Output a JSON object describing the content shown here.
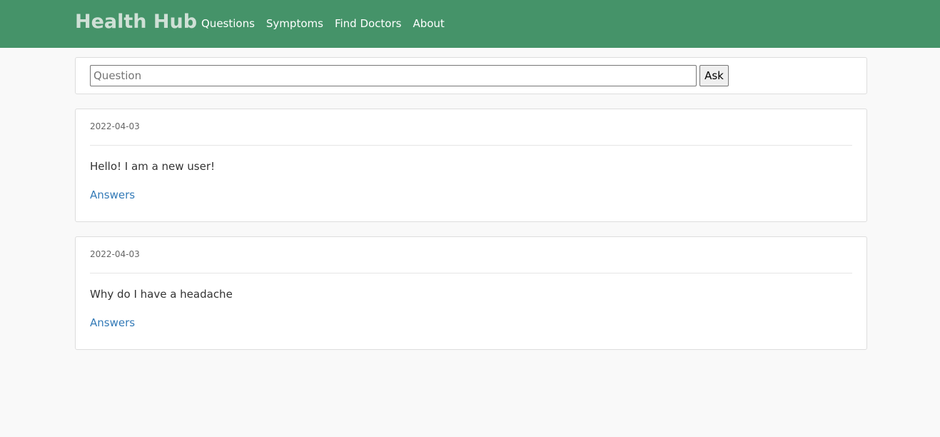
{
  "navbar": {
    "brand": "Health Hub",
    "links": [
      "Questions",
      "Symptoms",
      "Find Doctors",
      "About"
    ]
  },
  "ask": {
    "placeholder": "Question",
    "value": "",
    "button_label": "Ask"
  },
  "questions": [
    {
      "date": "2022-04-03",
      "text": "Hello! I am a new user!",
      "answers_label": "Answers"
    },
    {
      "date": "2022-04-03",
      "text": "Why do I have a headache",
      "answers_label": "Answers"
    }
  ],
  "colors": {
    "navbar_bg": "#459369",
    "brand_text": "#cfe0d6",
    "link": "#337ab7",
    "page_bg": "#f9f9f9"
  }
}
